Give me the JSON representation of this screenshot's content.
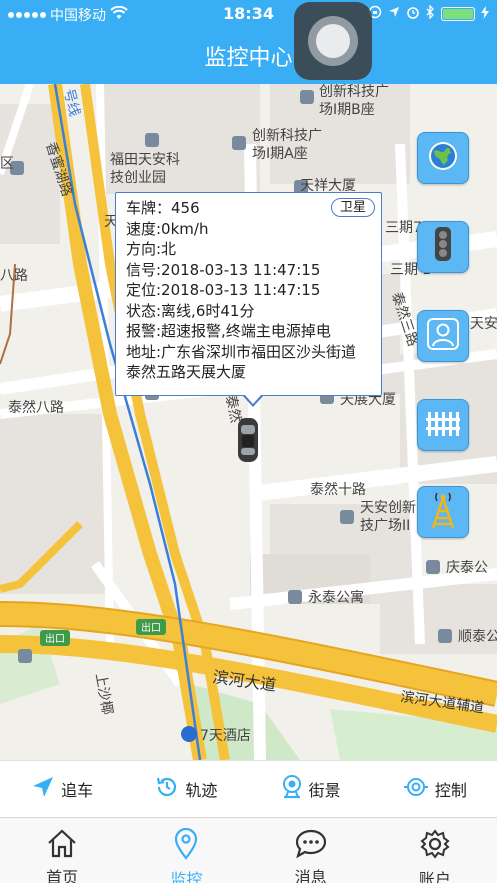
{
  "status_bar": {
    "carrier": "中国移动",
    "time": "18:34"
  },
  "nav": {
    "title": "监控中心"
  },
  "map": {
    "labels": {
      "chuangxin_b": "创新科技广",
      "chuangxin_b2": "场I期B座",
      "chuangxin_a": "创新科技广",
      "chuangxin_a2": "场I期A座",
      "futian": "福田天安科",
      "futian2": "技创业园",
      "tianxiang": "天祥大厦",
      "xiangmi": "香蜜湖路",
      "ba_lu": "八路",
      "tairan8": "泰然八路",
      "tairan3": "三期7",
      "sanqi_b": "三期 B",
      "tairan_san": "泰然三路",
      "tianan": "天安",
      "tianzhan": "天展大厦",
      "tairan10": "泰然十路",
      "tianan_cx": "天安创新",
      "tianan_cx2": "技广场II",
      "qingtai": "庆泰公",
      "yongtai": "永泰公寓",
      "shuntai": "顺泰公",
      "binhe": "滨河大道",
      "binhe_fu": "滨河大道辅道",
      "exit": "出口",
      "qitian": "7天酒店",
      "shasha": "上沙椰",
      "hao": "号线",
      "qu": "区",
      "tairan_w": "泰然",
      "tian_v": "天"
    }
  },
  "popup": {
    "satellite_button": "卫星",
    "plate": "车牌：456",
    "speed": "速度:0km/h",
    "direction": "方向:北",
    "signal": "信号:2018-03-13 11:47:15",
    "position": "定位:2018-03-13 11:47:15",
    "state": "状态:离线,6时41分",
    "alarm": "报警:超速报警,终端主电源掉电",
    "address": "地址:广东省深圳市福田区沙头街道泰然五路天展大厦"
  },
  "side_buttons": [
    {
      "name": "globe-icon"
    },
    {
      "name": "traffic-light-icon"
    },
    {
      "name": "person-icon"
    },
    {
      "name": "fence-icon"
    },
    {
      "name": "signal-tower-icon"
    }
  ],
  "actions": {
    "chase": "追车",
    "track": "轨迹",
    "street_view": "街景",
    "control": "控制"
  },
  "tabs": {
    "home": "首页",
    "monitor": "监控",
    "messages": "消息",
    "account": "账户"
  },
  "colors": {
    "brand": "#3aaef5",
    "map_bg": "#f2f0eb",
    "road_major": "#f5c23c"
  }
}
